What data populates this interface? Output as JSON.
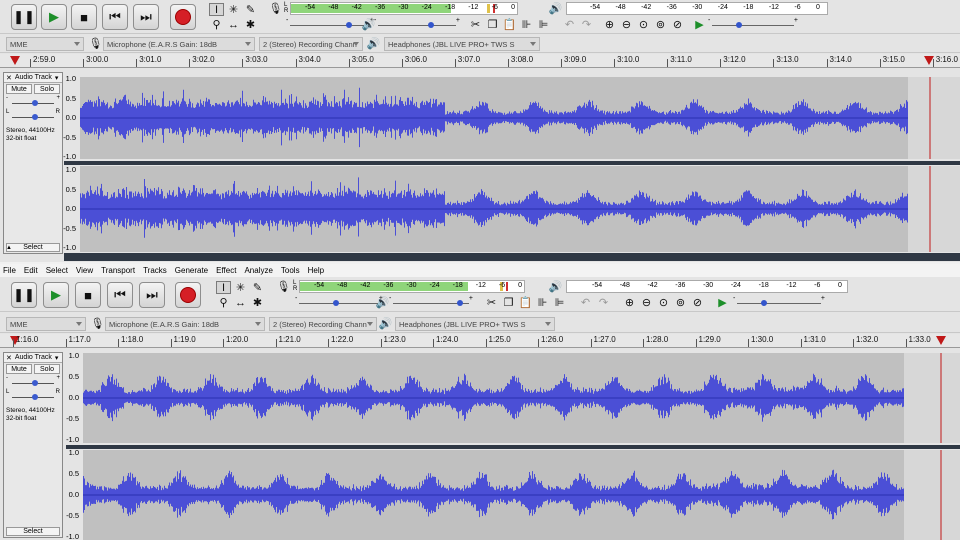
{
  "menu": {
    "file": "File",
    "edit": "Edit",
    "select": "Select",
    "view": "View",
    "transport": "Transport",
    "tracks": "Tracks",
    "generate": "Generate",
    "effect": "Effect",
    "analyze": "Analyze",
    "tools": "Tools",
    "help": "Help"
  },
  "meter_scale": {
    "rec": [
      "-54",
      "-48",
      "-42",
      "-36",
      "-30",
      "-24",
      "-18",
      "-12",
      "-6",
      "0"
    ],
    "play": [
      "-54",
      "-48",
      "-42",
      "-36",
      "-30",
      "-24",
      "-18",
      "-12",
      "-6",
      "0"
    ]
  },
  "meter_levels": {
    "top": 0.7,
    "bottom": 0.74
  },
  "devices": {
    "host": "MME",
    "mic": "Microphone (E.A.R.S Gain: 18dB",
    "channels": "2 (Stereo) Recording Chann",
    "speaker": "Headphones (JBL LIVE PRO+ TWS S"
  },
  "top": {
    "ruler": [
      "2:59.0",
      "3:00.0",
      "3:01.0",
      "3:02.0",
      "3:03.0",
      "3:04.0",
      "3:05.0",
      "3:06.0",
      "3:07.0",
      "3:08.0",
      "3:09.0",
      "3:10.0",
      "3:11.0",
      "3:12.0",
      "3:13.0",
      "3:14.0",
      "3:15.0",
      "3:16.0"
    ]
  },
  "bottom": {
    "ruler": [
      "1:16.0",
      "1:17.0",
      "1:18.0",
      "1:19.0",
      "1:20.0",
      "1:21.0",
      "1:22.0",
      "1:23.0",
      "1:24.0",
      "1:25.0",
      "1:26.0",
      "1:27.0",
      "1:28.0",
      "1:29.0",
      "1:30.0",
      "1:31.0",
      "1:32.0",
      "1:33.0"
    ]
  },
  "track": {
    "name": "Audio Track",
    "mute": "Mute",
    "solo": "Solo",
    "rate": "Stereo, 44100Hz",
    "format": "32-bit float",
    "select": "Select",
    "l": "L",
    "r": "R",
    "minus": "-",
    "plus": "+"
  },
  "scale": [
    "1.0",
    "0.5",
    "0.0",
    "-0.5",
    "-1.0"
  ],
  "icons": {
    "pause": "pause-icon",
    "play": "play-icon",
    "stop": "stop-icon",
    "skip_start": "skip-start-icon",
    "skip_end": "skip-end-icon",
    "record": "record-icon"
  },
  "colors": {
    "wave": "#4b4fd6",
    "wave_bg": "#c0c0c0",
    "playhead": "#c01818"
  }
}
